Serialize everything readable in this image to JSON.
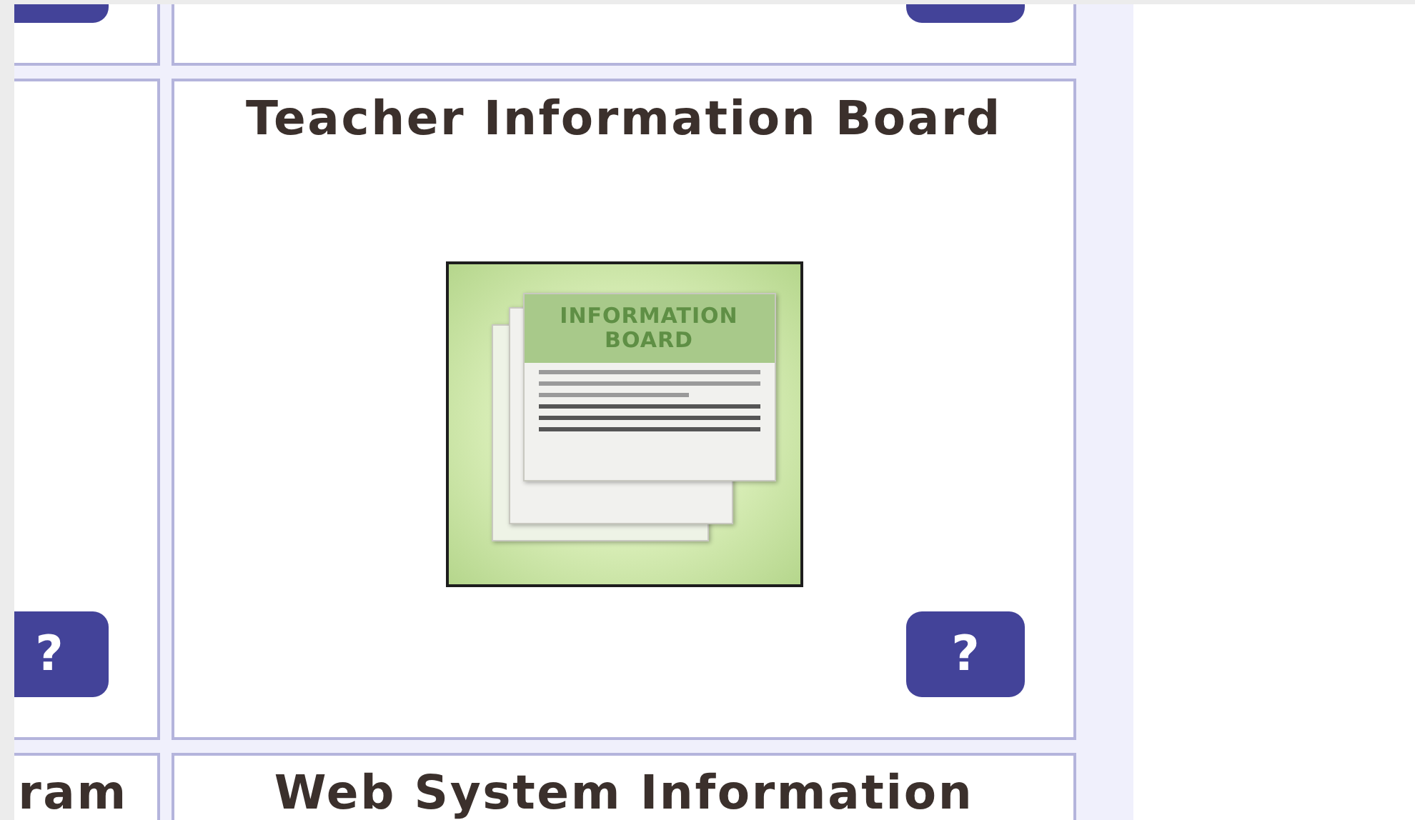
{
  "rows": [
    {
      "cells": [
        {
          "help_button": true
        },
        {
          "help_button": true
        }
      ]
    },
    {
      "cells": [
        {
          "help_button": true,
          "help_label": "?"
        },
        {
          "title": "Teacher Information Board",
          "icon": {
            "caption_lines": [
              "INFORMATION",
              "BOARD"
            ]
          },
          "help_button": true,
          "help_label": "?"
        }
      ]
    },
    {
      "cells": [
        {
          "title": "ram",
          "help_button": false
        },
        {
          "title": "Web System Information",
          "help_button": false
        }
      ]
    }
  ]
}
